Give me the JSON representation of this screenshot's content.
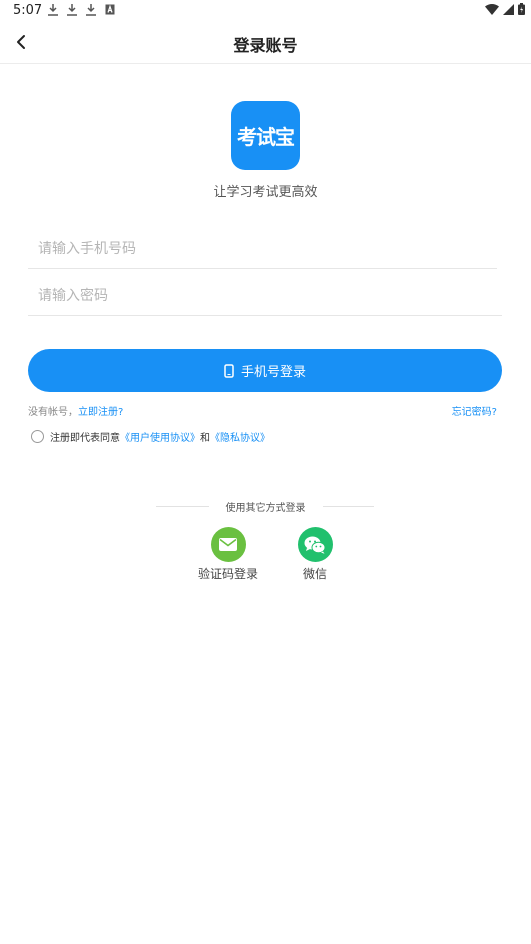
{
  "status_bar": {
    "time": "5:07",
    "left_icons": [
      "download-icon",
      "download-icon",
      "download-icon",
      "a-box-icon"
    ],
    "right_icons": [
      "wifi-icon",
      "signal-icon",
      "battery-icon"
    ]
  },
  "header": {
    "title": "登录账号",
    "back_icon": "chevron-left-icon"
  },
  "logo": {
    "text": "考试宝",
    "color": "#1890f5"
  },
  "slogan": "让学习考试更高效",
  "form": {
    "phone_placeholder": "请输入手机号码",
    "phone_value": "",
    "password_placeholder": "请输入密码",
    "password_value": ""
  },
  "login_button": {
    "label": "手机号登录",
    "icon": "phone-icon",
    "color": "#1890f5"
  },
  "register": {
    "prefix": "没有帐号，",
    "link": "立即注册?"
  },
  "forgot_password": "忘记密码?",
  "agreement": {
    "checked": false,
    "prefix": "注册即代表同意",
    "user_agreement": "《用户使用协议》",
    "and": "和",
    "privacy": "《隐私协议》"
  },
  "other_login": {
    "title": "使用其它方式登录",
    "options": [
      {
        "label": "验证码登录",
        "icon": "mail-icon",
        "color": "#6ac040"
      },
      {
        "label": "微信",
        "icon": "wechat-icon",
        "color": "#21c06d"
      }
    ]
  }
}
